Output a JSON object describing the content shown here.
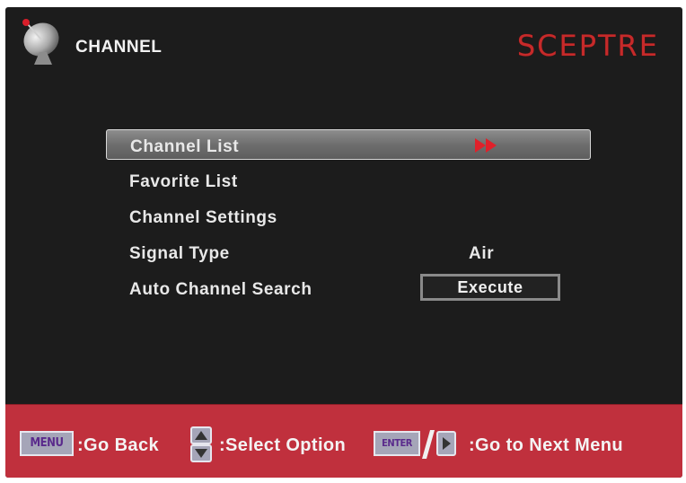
{
  "header": {
    "title": "CHANNEL",
    "brand": "SCEPTRE",
    "icon": "satellite-dish-icon"
  },
  "menu": {
    "items": [
      {
        "label": "Channel List",
        "selected": true,
        "icon": "double-arrow-right-icon"
      },
      {
        "label": "Favorite List"
      },
      {
        "label": "Channel Settings"
      },
      {
        "label": "Signal Type",
        "value": "Air"
      },
      {
        "label": "Auto Channel Search",
        "button": "Execute"
      }
    ]
  },
  "footer": {
    "menu_key": "MENU",
    "back_text": ":Go Back",
    "select_text": ":Select Option",
    "enter_key": "ENTER",
    "next_text": ":Go to Next Menu",
    "icons": [
      "up-down-arrows-icon",
      "right-arrow-icon"
    ]
  },
  "colors": {
    "background": "#1c1c1c",
    "footer": "#c0303d",
    "brand": "#c62a2a",
    "highlight": "#7a7a7a",
    "arrow": "#e0202a"
  }
}
